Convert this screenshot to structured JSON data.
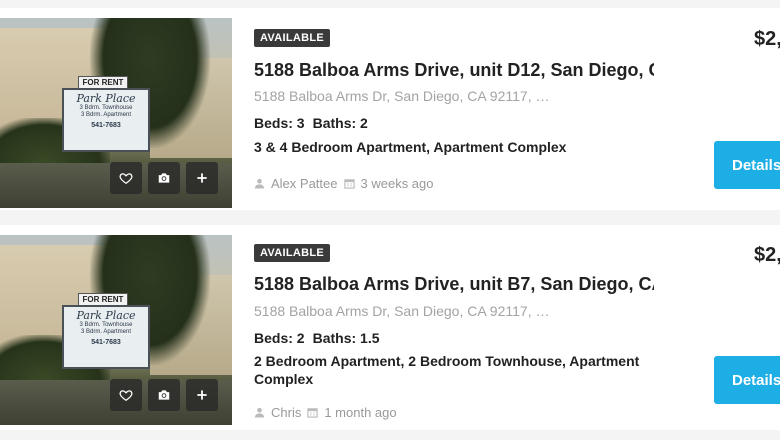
{
  "listings": [
    {
      "status": "AVAILABLE",
      "title": "5188 Balboa Arms Drive, unit D12, San Diego, C…",
      "address": "5188 Balboa Arms Dr, San Diego, CA 92117, …",
      "beds": "Beds: 3",
      "baths": "Baths: 2",
      "types": "3 & 4 Bedroom Apartment, Apartment Complex",
      "author": "Alex Pattee",
      "date": "3 weeks ago",
      "price": "$2,",
      "details_label": "Details",
      "photo_sign": {
        "header": "FOR RENT",
        "name": "Park Place",
        "line1": "3 Bdrm. Townhouse",
        "line2": "3 Bdrm. Apartment",
        "phone": "541-7683"
      }
    },
    {
      "status": "AVAILABLE",
      "title": "5188 Balboa Arms Drive, unit B7, San Diego, CA …",
      "address": "5188 Balboa Arms Dr, San Diego, CA 92117, …",
      "beds": "Beds: 2",
      "baths": "Baths: 1.5",
      "types": "2 Bedroom Apartment, 2 Bedroom Townhouse, Apartment Complex",
      "author": "Chris",
      "date": "1 month ago",
      "price": "$2,",
      "details_label": "Details",
      "photo_sign": {
        "header": "FOR RENT",
        "name": "Park Place",
        "line1": "3 Bdrm. Townhouse",
        "line2": "3 Bdrm. Apartment",
        "phone": "541-7683"
      }
    }
  ],
  "icons": {
    "favorite": "heart-icon",
    "photos": "camera-icon",
    "compare": "plus-icon",
    "author": "user-icon",
    "date": "calendar-icon"
  },
  "colors": {
    "accent": "#1eaee6",
    "badge": "#3a3a3a",
    "muted": "#a3a3a3"
  }
}
